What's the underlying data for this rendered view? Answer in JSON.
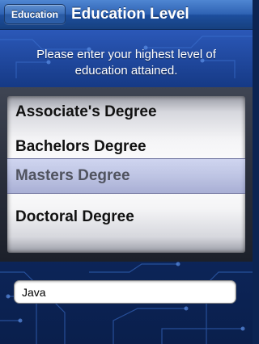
{
  "navbar": {
    "back_label": "Education",
    "title": "Education Level"
  },
  "instructions": "Please enter your highest level of education attained.",
  "picker": {
    "options": [
      "Associate's Degree",
      "Bachelors Degree",
      "Masters Degree",
      "Doctoral Degree"
    ],
    "selected": "Masters Degree"
  },
  "text_field": {
    "value": "Java"
  },
  "colors": {
    "navbar": "#2f63b4",
    "background": "#0c2452",
    "selection": "#9aa3d8"
  }
}
